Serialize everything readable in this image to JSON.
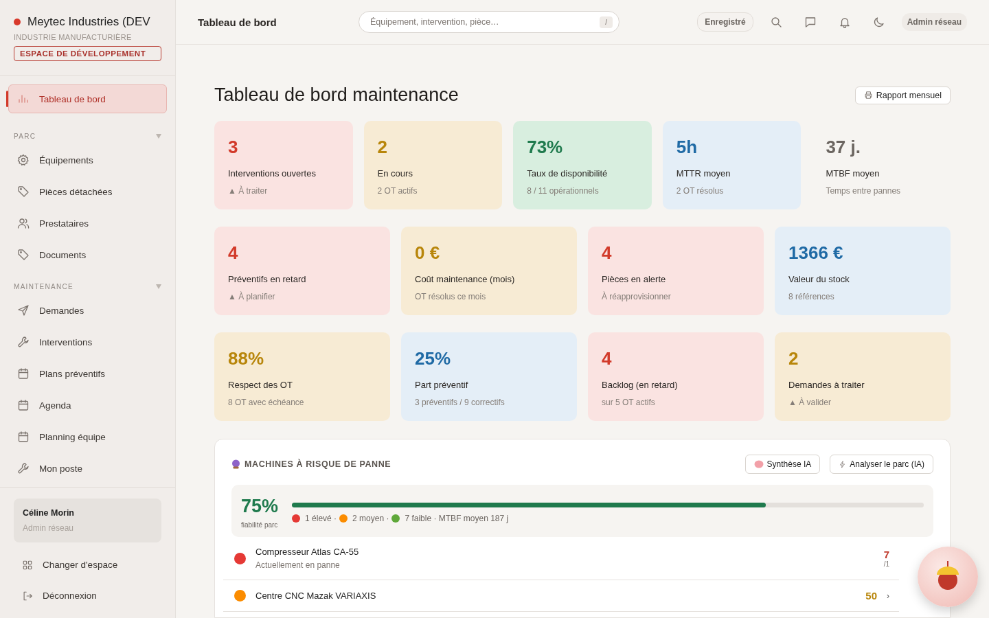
{
  "sidebar": {
    "org_name": "Meytec Industries (DEV",
    "org_type": "INDUSTRIE MANUFACTURIÈRE",
    "env_badge": "ESPACE DE DÉVELOPPEMENT",
    "top_item": {
      "label": "Tableau de bord",
      "selected": true
    },
    "sections": [
      {
        "title": "PARC",
        "expanded": true,
        "items": [
          {
            "label": "Équipements",
            "selected": false
          },
          {
            "label": "Pièces détachées",
            "selected": false
          },
          {
            "label": "Prestataires",
            "selected": false
          },
          {
            "label": "Documents",
            "selected": false
          }
        ]
      },
      {
        "title": "MAINTENANCE",
        "expanded": true,
        "items": [
          {
            "label": "Demandes",
            "selected": false
          },
          {
            "label": "Interventions",
            "selected": false
          },
          {
            "label": "Plans préventifs",
            "selected": false
          },
          {
            "label": "Agenda",
            "selected": false
          },
          {
            "label": "Planning équipe",
            "selected": false
          },
          {
            "label": "Mon poste",
            "selected": false
          }
        ]
      }
    ],
    "user": {
      "name": "Céline Morin",
      "role": "Admin réseau"
    },
    "footer_items": [
      {
        "label": "Changer d'espace"
      },
      {
        "label": "Déconnexion"
      }
    ]
  },
  "header": {
    "title": "Tableau de bord",
    "search": {
      "placeholder": "Équipement, intervention, pièce…",
      "shortcut": "/"
    },
    "save_status": "Enregistré",
    "role": "Admin réseau"
  },
  "page": {
    "title": "Tableau de bord maintenance",
    "report_button": "Rapport mensuel"
  },
  "kpi_rows": [
    [
      {
        "kind": "alert",
        "value": "3",
        "label": "Interventions ouvertes",
        "sub": "▲ À traiter"
      },
      {
        "kind": "warning",
        "value": "2",
        "label": "En cours",
        "sub": "2 OT actifs"
      },
      {
        "kind": "success",
        "value": "73%",
        "label": "Taux de disponibilité",
        "sub": "8 / 11 opérationnels"
      },
      {
        "kind": "info",
        "value": "5h",
        "label": "MTTR moyen",
        "sub": "2 OT résolus"
      },
      {
        "kind": "neutral",
        "value": "37 j.",
        "label": "MTBF moyen",
        "sub": "Temps entre pannes"
      }
    ],
    [
      {
        "kind": "alert",
        "value": "4",
        "label": "Préventifs en retard",
        "sub": "▲ À planifier"
      },
      {
        "kind": "warning",
        "value": "0 €",
        "label": "Coût maintenance (mois)",
        "sub": "OT résolus ce mois"
      },
      {
        "kind": "alert",
        "value": "4",
        "label": "Pièces en alerte",
        "sub": "À réapprovisionner"
      },
      {
        "kind": "info",
        "value": "1366 €",
        "label": "Valeur du stock",
        "sub": "8 références"
      }
    ],
    [
      {
        "kind": "warning",
        "value": "88%",
        "label": "Respect des OT",
        "sub": "8 OT avec échéance"
      },
      {
        "kind": "info",
        "value": "25%",
        "label": "Part préventif",
        "sub": "3 préventifs / 9 correctifs"
      },
      {
        "kind": "alert",
        "value": "4",
        "label": "Backlog (en retard)",
        "sub": "sur 5 OT actifs"
      },
      {
        "kind": "warning",
        "value": "2",
        "label": "Demandes à traiter",
        "sub": "▲ À valider"
      }
    ]
  ],
  "risk_panel": {
    "title": "MACHINES À RISQUE DE PANNE",
    "buttons": [
      {
        "label": "Synthèse IA"
      },
      {
        "label": "Analyser le parc (IA)"
      }
    ],
    "reliability": {
      "value": "75%",
      "caption": "fiabilité parc",
      "level": 0.75
    },
    "legend": [
      {
        "color": "#e53935",
        "label": "1 élevé ·"
      },
      {
        "color": "#fb8c00",
        "label": "2 moyen ·"
      },
      {
        "color": "#5fa83a",
        "label": "7 faible · MTBF moyen 187 j"
      }
    ],
    "machines": [
      {
        "color": "#e53935",
        "name": "Compresseur Atlas CA-55",
        "status": "Actuellement en panne",
        "score": "7",
        "scale": "/1"
      },
      {
        "color": "#fb8c00",
        "name": "Centre CNC Mazak VARIAXIS",
        "score": "50",
        "chevron": "›"
      }
    ]
  }
}
